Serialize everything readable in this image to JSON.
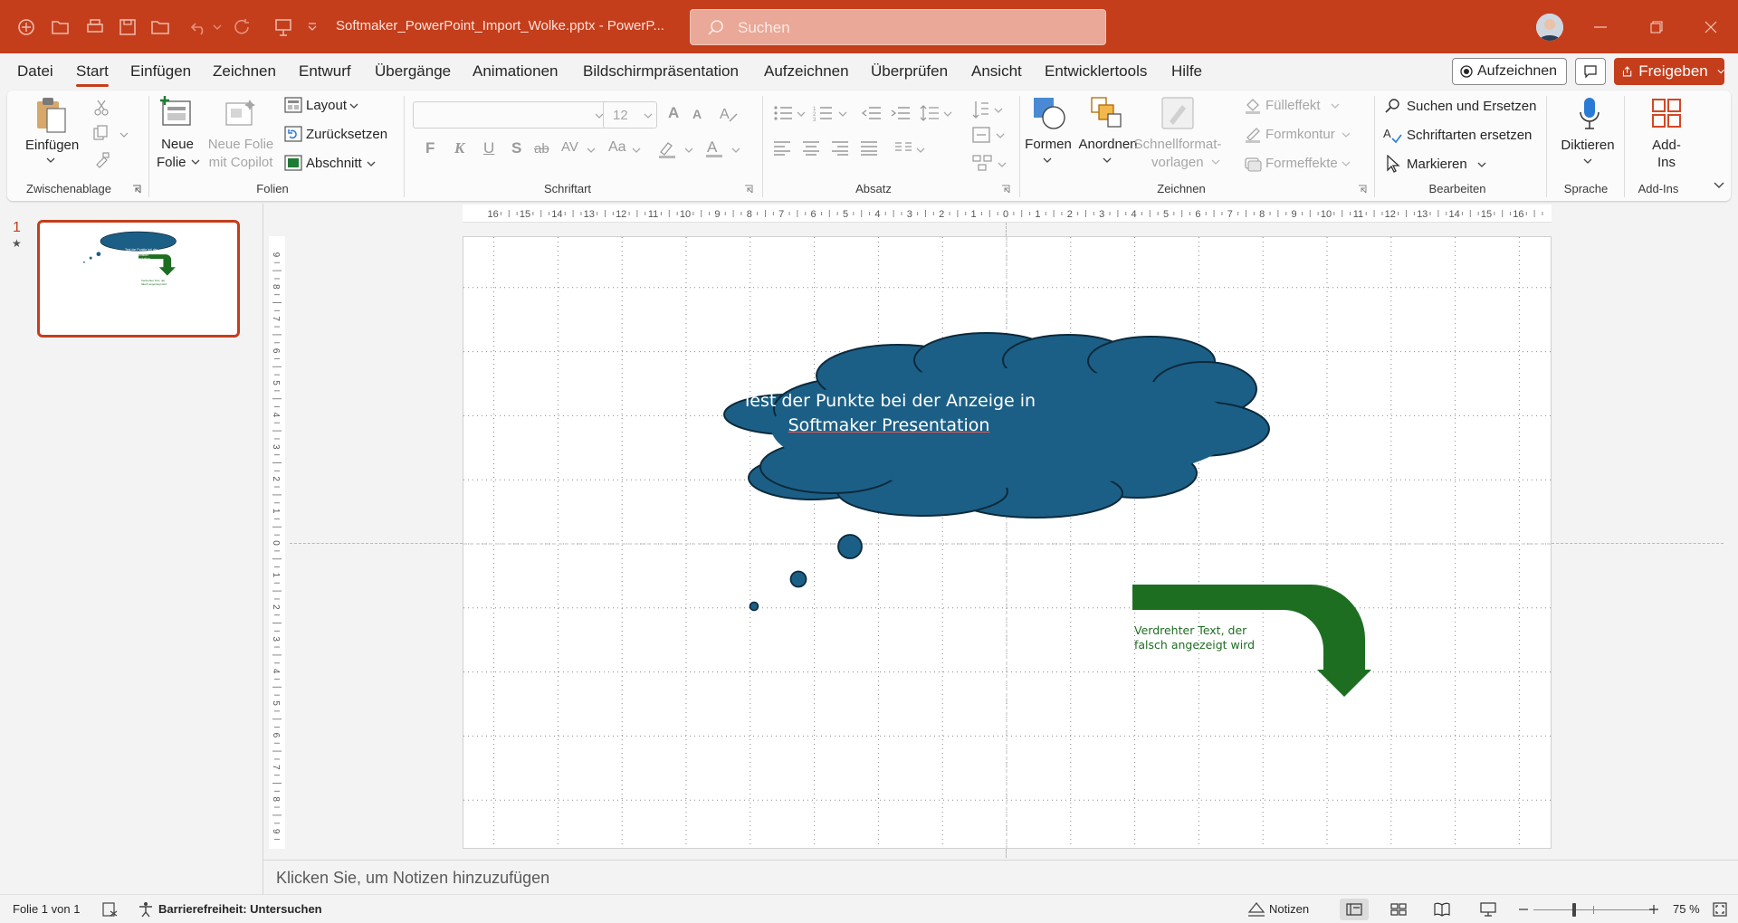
{
  "window": {
    "doc_title": "Softmaker_PowerPoint_Import_Wolke.pptx  -  PowerP...",
    "search_placeholder": "Suchen"
  },
  "colors": {
    "accent": "#c43e1c",
    "cloud_fill": "#1c5f86",
    "arrow_fill": "#1e6e22"
  },
  "menu": {
    "tabs": [
      "Datei",
      "Start",
      "Einfügen",
      "Zeichnen",
      "Entwurf",
      "Übergänge",
      "Animationen",
      "Bildschirmpräsentation",
      "Aufzeichnen",
      "Überprüfen",
      "Ansicht",
      "Entwicklertools",
      "Hilfe"
    ],
    "active": "Start",
    "record_label": "Aufzeichnen",
    "share_label": "Freigeben"
  },
  "ribbon": {
    "clipboard": {
      "paste": "Einfügen",
      "group": "Zwischenablage"
    },
    "slides": {
      "new_slide_1": "Neue",
      "new_slide_2": "Folie",
      "copilot_1": "Neue Folie",
      "copilot_2": "mit Copilot",
      "layout": "Layout",
      "reset": "Zurücksetzen",
      "section": "Abschnitt",
      "group": "Folien"
    },
    "font": {
      "size": "12",
      "group": "Schriftart",
      "bold": "F",
      "italic": "K",
      "underline": "U",
      "strike": "S",
      "strike2": "ab",
      "spacing": "AV",
      "case": "Aa",
      "grow": "A",
      "shrink": "A"
    },
    "paragraph": {
      "group": "Absatz"
    },
    "drawing": {
      "shapes": "Formen",
      "arrange": "Anordnen",
      "quick_1": "Schnellformat-",
      "quick_2": "vorlagen",
      "fill": "Fülleffekt",
      "outline": "Formkontur",
      "effects": "Formeffekte",
      "group": "Zeichnen"
    },
    "editing": {
      "find": "Suchen und Ersetzen",
      "replace_fonts": "Schriftarten ersetzen",
      "select": "Markieren",
      "group": "Bearbeiten"
    },
    "voice": {
      "dictate": "Diktieren",
      "group": "Sprache"
    },
    "addins": {
      "label_1": "Add-",
      "label_2": "Ins",
      "group": "Add-Ins"
    }
  },
  "thumbnails": {
    "slide_number": "1",
    "star": "★"
  },
  "slide": {
    "cloud_text_1": "Test der Punkte bei der Anzeige in",
    "cloud_text_2": "Softmaker Presentation",
    "arrow_text_1": "Verdrehter Text, der",
    "arrow_text_2": "falsch angezeigt wird"
  },
  "rulers": {
    "horizontal": [
      "16",
      "15",
      "14",
      "13",
      "12",
      "11",
      "10",
      "9",
      "8",
      "7",
      "6",
      "5",
      "4",
      "3",
      "2",
      "1",
      "0",
      "1",
      "2",
      "3",
      "4",
      "5",
      "6",
      "7",
      "8",
      "9",
      "10",
      "11",
      "12",
      "13",
      "14",
      "15",
      "16"
    ],
    "vertical": [
      "9",
      "8",
      "7",
      "6",
      "5",
      "4",
      "3",
      "2",
      "1",
      "0",
      "1",
      "2",
      "3",
      "4",
      "5",
      "6",
      "7",
      "8",
      "9"
    ]
  },
  "notes": {
    "placeholder": "Klicken Sie, um Notizen hinzuzufügen"
  },
  "status": {
    "slide_of": "Folie 1 von 1",
    "accessibility": "Barrierefreiheit: Untersuchen",
    "notes": "Notizen",
    "zoom": "75 %"
  }
}
